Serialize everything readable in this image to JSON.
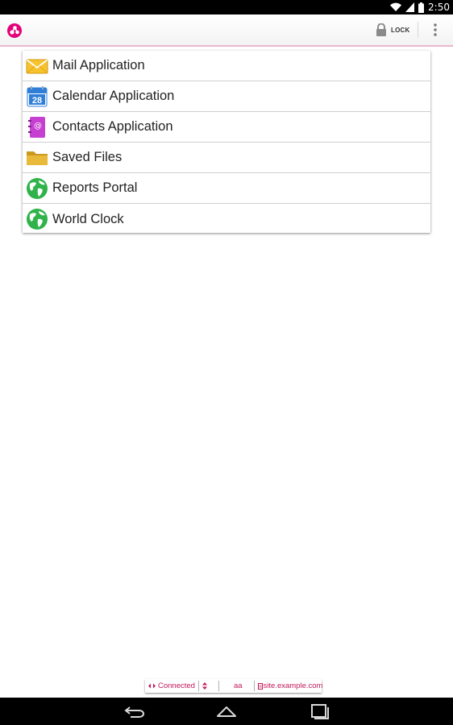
{
  "status_bar": {
    "time": "2:50",
    "icons": [
      "wifi-icon",
      "cellular-signal-icon",
      "battery-icon"
    ]
  },
  "action_bar": {
    "logo_icon": "app-logo-icon",
    "lock_label": "LOCK",
    "lock_icon": "padlock-icon",
    "overflow_icon": "overflow-menu-icon",
    "accent_color": "#e40077"
  },
  "apps": [
    {
      "label": "Mail Application",
      "icon": "envelope-icon"
    },
    {
      "label": "Calendar Application",
      "icon": "calendar-icon",
      "icon_text": "28"
    },
    {
      "label": "Contacts Application",
      "icon": "contacts-book-icon",
      "icon_text": "@"
    },
    {
      "label": "Saved Files",
      "icon": "folder-icon"
    },
    {
      "label": "Reports Portal",
      "icon": "globe-icon"
    },
    {
      "label": "World Clock",
      "icon": "globe-icon"
    }
  ],
  "info_strip": {
    "connection": "Connected",
    "font_size": "aa",
    "site": "site.example.com"
  },
  "nav_bar": {
    "buttons": [
      "back-icon",
      "home-icon",
      "recent-apps-icon"
    ]
  }
}
